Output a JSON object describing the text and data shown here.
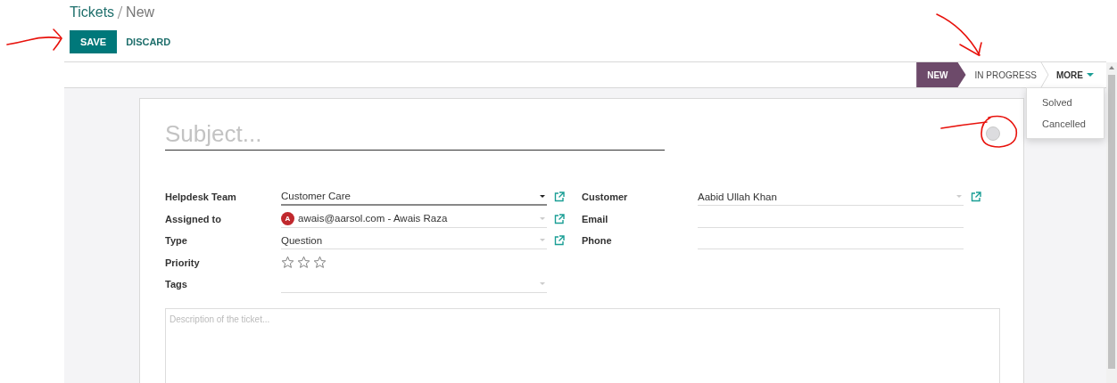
{
  "breadcrumb": [
    {
      "label": "Tickets",
      "kind": "link"
    },
    {
      "label": "New",
      "kind": "current"
    }
  ],
  "buttons": [
    {
      "label": "SAVE",
      "kind": "primary"
    },
    {
      "label": "DISCARD",
      "kind": "link"
    }
  ],
  "stages": [
    {
      "label": "NEW",
      "selected": true
    },
    {
      "label": "IN PROGRESS",
      "selected": false
    }
  ],
  "more_menu": {
    "label": "MORE",
    "expanded": true,
    "items": [
      "Solved",
      "Cancelled"
    ]
  },
  "form": {
    "subject": {
      "placeholder": "Subject..."
    },
    "left_fields": [
      {
        "label": "Helpdesk Team",
        "kind": "select",
        "value": "Customer Care",
        "focused": true,
        "has_link": true
      },
      {
        "label": "Assigned to",
        "kind": "select",
        "value": "awais@aarsol.com - Awais Raza",
        "avatar": "A",
        "focused": false,
        "has_link": true
      },
      {
        "label": "Type",
        "kind": "select",
        "value": "Question",
        "focused": false,
        "has_link": true
      },
      {
        "label": "Priority",
        "kind": "stars",
        "stars": 0
      },
      {
        "label": "Tags",
        "kind": "select",
        "focused": false,
        "has_link": false
      }
    ],
    "right_fields": [
      {
        "label": "Customer",
        "kind": "select",
        "value": "Aabid Ullah Khan",
        "focused": false,
        "has_link": true
      },
      {
        "label": "Email",
        "kind": "text"
      },
      {
        "label": "Phone",
        "kind": "text"
      }
    ],
    "description": {
      "placeholder": "Description of the ticket..."
    }
  }
}
